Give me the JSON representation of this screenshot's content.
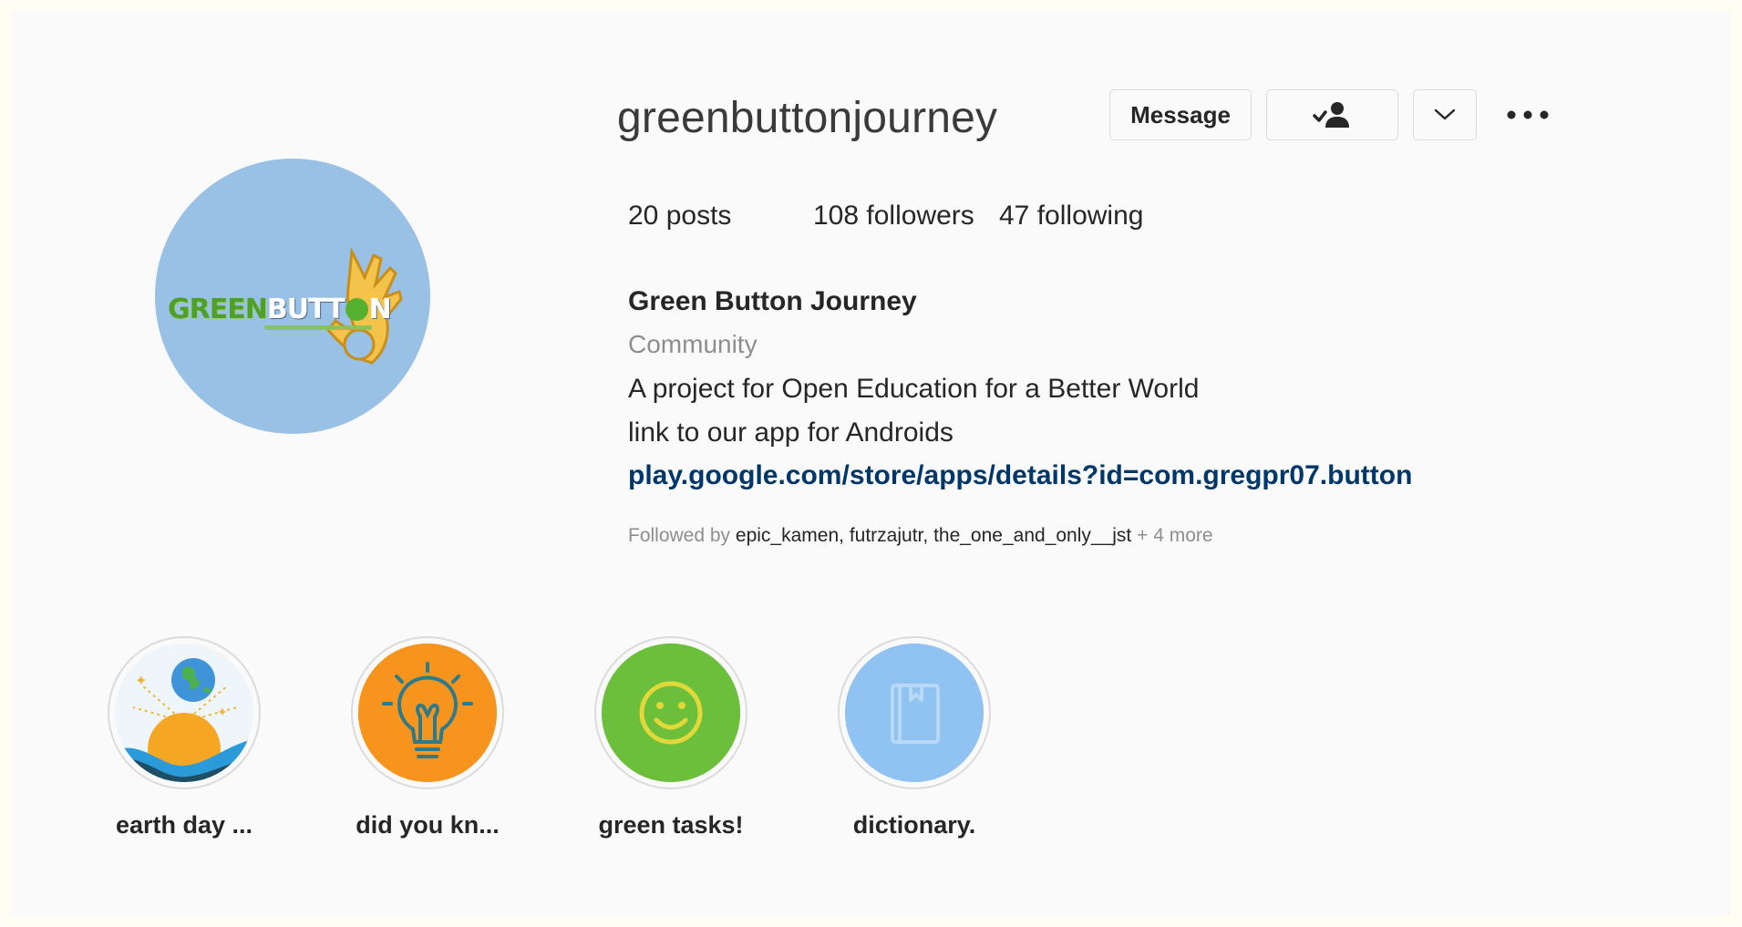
{
  "profile": {
    "username": "greenbuttonjourney",
    "full_name": "Green Button Journey",
    "category": "Community",
    "bio_line1": "A project for Open Education for a Better World",
    "bio_line2": "link to our app for Androids",
    "link": "play.google.com/store/apps/details?id=com.gregpr07.button",
    "avatar_logo": {
      "text_green": "GREEN",
      "text_white_1": "BUTT",
      "text_white_2": "N",
      "icon": "ok-hand-icon"
    }
  },
  "actions": {
    "message_label": "Message",
    "following_icon": "person-check-icon",
    "dropdown_icon": "chevron-down-icon",
    "more_icon": "more-dots-icon"
  },
  "stats": {
    "posts_count": "20",
    "posts_label": "posts",
    "followers_count": "108",
    "followers_label": "followers",
    "following_count": "47",
    "following_label": "following"
  },
  "followed_by": {
    "prefix": "Followed by",
    "names": [
      "epic_kamen",
      "futrzajutr",
      "the_one_and_only__jst"
    ],
    "more": "+ 4 more"
  },
  "highlights": [
    {
      "label": "earth day ...",
      "icon": "earth-sun-icon",
      "color": "#ffffff"
    },
    {
      "label": "did you kn...",
      "icon": "lightbulb-icon",
      "color": "#f7941d"
    },
    {
      "label": "green tasks!",
      "icon": "smiley-icon",
      "color": "#6bbf3b"
    },
    {
      "label": "dictionary.",
      "icon": "book-icon",
      "color": "#90c2f2"
    }
  ],
  "colors": {
    "background": "#fafafa",
    "border": "#fffef3",
    "link": "#00376b",
    "muted": "#8e8e8e",
    "avatar_bg": "#99c0e5"
  }
}
